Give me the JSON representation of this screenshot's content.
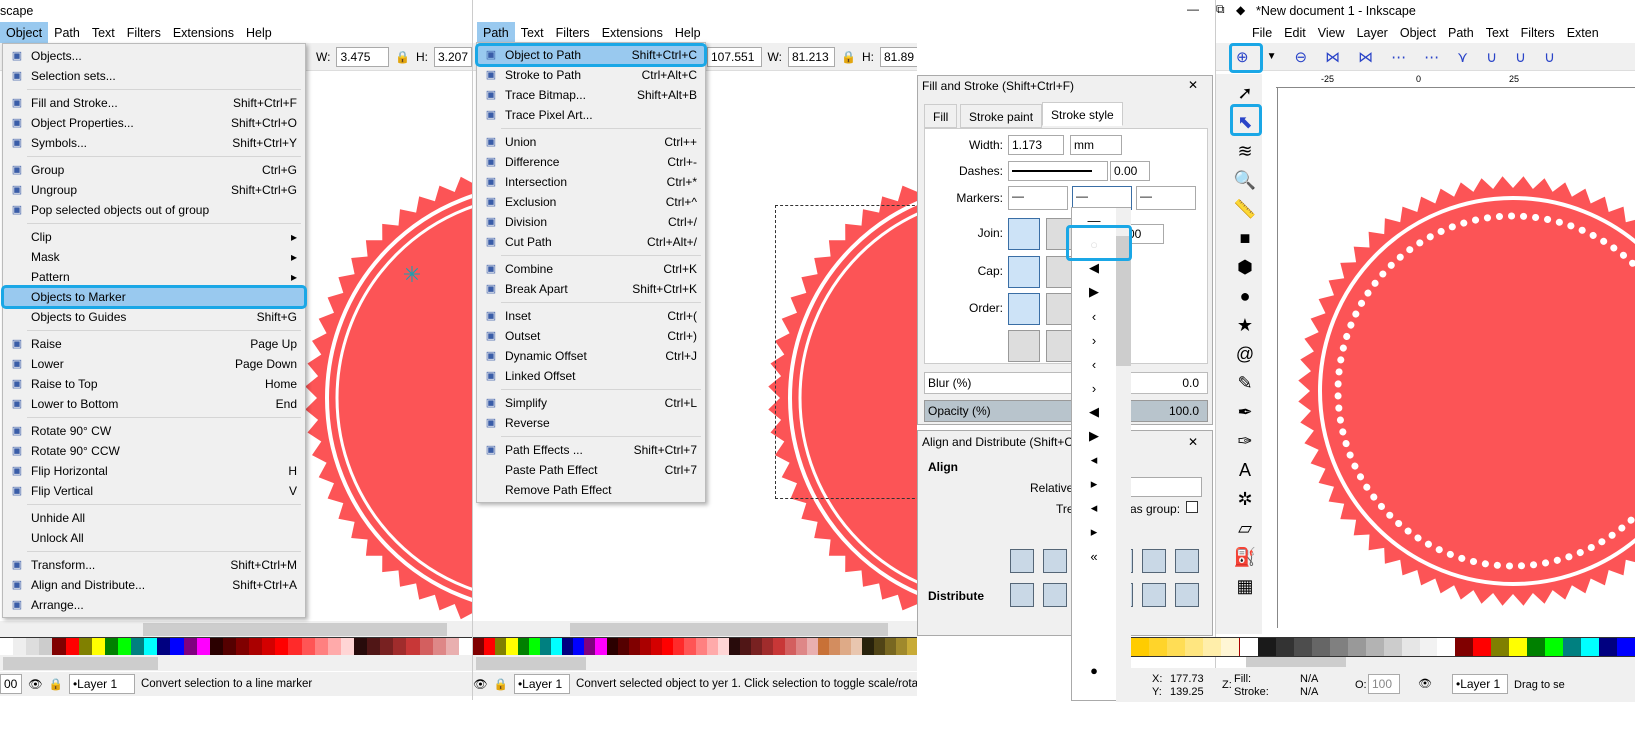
{
  "left_window": {
    "title": "scape",
    "menubar": [
      "Object",
      "Path",
      "Text",
      "Filters",
      "Extensions",
      "Help"
    ],
    "active_menu": "Object",
    "toolbar": {
      "w_label": "W:",
      "w_value": "3.475",
      "h_label": "H:",
      "h_value": "3.207"
    },
    "status": {
      "zoom": "00",
      "layer": "•Layer 1",
      "message": "Convert selection to a line marker"
    }
  },
  "object_menu": [
    [
      {
        "label": "Objects...",
        "icon": "objects-icon"
      },
      {
        "label": "Selection sets...",
        "icon": "selection-sets-icon"
      }
    ],
    [
      {
        "label": "Fill and Stroke...",
        "shortcut": "Shift+Ctrl+F",
        "icon": "fill-stroke-icon"
      },
      {
        "label": "Object Properties...",
        "shortcut": "Shift+Ctrl+O",
        "icon": "object-properties-icon"
      },
      {
        "label": "Symbols...",
        "shortcut": "Shift+Ctrl+Y",
        "icon": "symbols-icon"
      }
    ],
    [
      {
        "label": "Group",
        "shortcut": "Ctrl+G",
        "icon": "group-icon"
      },
      {
        "label": "Ungroup",
        "shortcut": "Shift+Ctrl+G",
        "icon": "ungroup-icon"
      },
      {
        "label": "Pop selected objects out of group",
        "icon": "pop-out-icon"
      }
    ],
    [
      {
        "label": "Clip",
        "submenu": true
      },
      {
        "label": "Mask",
        "submenu": true
      },
      {
        "label": "Pattern",
        "submenu": true
      },
      {
        "label": "Objects to Marker",
        "highlighted": true
      },
      {
        "label": "Objects to Guides",
        "shortcut": "Shift+G"
      }
    ],
    [
      {
        "label": "Raise",
        "shortcut": "Page Up",
        "icon": "raise-icon"
      },
      {
        "label": "Lower",
        "shortcut": "Page Down",
        "icon": "lower-icon"
      },
      {
        "label": "Raise to Top",
        "shortcut": "Home",
        "icon": "raise-top-icon"
      },
      {
        "label": "Lower to Bottom",
        "shortcut": "End",
        "icon": "lower-bottom-icon"
      }
    ],
    [
      {
        "label": "Rotate 90° CW",
        "icon": "rotate-cw-icon"
      },
      {
        "label": "Rotate 90° CCW",
        "icon": "rotate-ccw-icon"
      },
      {
        "label": "Flip Horizontal",
        "shortcut": "H",
        "icon": "flip-horizontal-icon"
      },
      {
        "label": "Flip Vertical",
        "shortcut": "V",
        "icon": "flip-vertical-icon"
      }
    ],
    [
      {
        "label": "Unhide All"
      },
      {
        "label": "Unlock All"
      }
    ],
    [
      {
        "label": "Transform...",
        "shortcut": "Shift+Ctrl+M",
        "icon": "transform-icon"
      },
      {
        "label": "Align and Distribute...",
        "shortcut": "Shift+Ctrl+A",
        "icon": "align-icon"
      },
      {
        "label": "Arrange...",
        "icon": "arrange-icon"
      }
    ]
  ],
  "middle_window": {
    "menubar": [
      "Path",
      "Text",
      "Filters",
      "Extensions",
      "Help"
    ],
    "active_menu": "Path",
    "toolbar": {
      "y_value": "107.551",
      "w_label": "W:",
      "w_value": "81.213",
      "h_label": "H:",
      "h_value": "81.89"
    },
    "status": {
      "layer": "•Layer 1",
      "message": "Convert selected object to yer 1. Click selection to toggle scale/rota"
    }
  },
  "path_menu": [
    [
      {
        "label": "Object to Path",
        "shortcut": "Shift+Ctrl+C",
        "highlighted": true,
        "icon": "object-to-path-icon"
      },
      {
        "label": "Stroke to Path",
        "shortcut": "Ctrl+Alt+C",
        "icon": "stroke-to-path-icon"
      },
      {
        "label": "Trace Bitmap...",
        "shortcut": "Shift+Alt+B",
        "icon": "trace-bitmap-icon"
      },
      {
        "label": "Trace Pixel Art...",
        "icon": "trace-pixel-art-icon"
      }
    ],
    [
      {
        "label": "Union",
        "shortcut": "Ctrl++",
        "icon": "union-icon"
      },
      {
        "label": "Difference",
        "shortcut": "Ctrl+-",
        "icon": "difference-icon"
      },
      {
        "label": "Intersection",
        "shortcut": "Ctrl+*",
        "icon": "intersection-icon"
      },
      {
        "label": "Exclusion",
        "shortcut": "Ctrl+^",
        "icon": "exclusion-icon"
      },
      {
        "label": "Division",
        "shortcut": "Ctrl+/",
        "icon": "division-icon"
      },
      {
        "label": "Cut Path",
        "shortcut": "Ctrl+Alt+/",
        "icon": "cut-path-icon"
      }
    ],
    [
      {
        "label": "Combine",
        "shortcut": "Ctrl+K",
        "icon": "combine-icon"
      },
      {
        "label": "Break Apart",
        "shortcut": "Shift+Ctrl+K",
        "icon": "break-apart-icon"
      }
    ],
    [
      {
        "label": "Inset",
        "shortcut": "Ctrl+(",
        "icon": "inset-icon"
      },
      {
        "label": "Outset",
        "shortcut": "Ctrl+)",
        "icon": "outset-icon"
      },
      {
        "label": "Dynamic Offset",
        "shortcut": "Ctrl+J",
        "icon": "dynamic-offset-icon"
      },
      {
        "label": "Linked Offset",
        "icon": "linked-offset-icon"
      }
    ],
    [
      {
        "label": "Simplify",
        "shortcut": "Ctrl+L",
        "icon": "simplify-icon"
      },
      {
        "label": "Reverse",
        "icon": "reverse-icon"
      }
    ],
    [
      {
        "label": "Path Effects ...",
        "shortcut": "Shift+Ctrl+7",
        "icon": "path-effects-icon"
      },
      {
        "label": "Paste Path Effect",
        "shortcut": "Ctrl+7"
      },
      {
        "label": "Remove Path Effect"
      }
    ]
  ],
  "fill_stroke": {
    "title": "Fill and Stroke (Shift+Ctrl+F)",
    "tabs": [
      "Fill",
      "Stroke paint",
      "Stroke style"
    ],
    "active_tab": "Stroke style",
    "width_label": "Width:",
    "width_value": "1.173",
    "unit": "mm",
    "dashes_label": "Dashes:",
    "dash_offset": "0.00",
    "markers_label": "Markers:",
    "join_label": "Join:",
    "miter_value": "00",
    "cap_label": "Cap:",
    "order_label": "Order:",
    "blur_label": "Blur (%)",
    "blur_value": "0.0",
    "opacity_label": "Opacity (%)",
    "opacity_value": "100.0"
  },
  "align_distribute": {
    "title": "Align and Distribute (Shift+C",
    "align_heading": "Align",
    "relative_label": "Relative",
    "treat_label": "Tre",
    "as_group_label": "as group:",
    "distribute_heading": "Distribute"
  },
  "marker_list": [
    "none",
    "dot-white",
    "arrow-large-left",
    "arrow-large-right",
    "arrow-small-left",
    "arrow-small-right",
    "arrow-tiny-left",
    "arrow-tiny-right",
    "triangle-large-left",
    "triangle-large-right",
    "triangle-small-left",
    "triangle-small-right",
    "triangle-tiny-left",
    "triangle-tiny-right",
    "chevrons-left",
    "dot-large"
  ],
  "right_window": {
    "title": "*New document 1 - Inkscape",
    "menubar": [
      "File",
      "Edit",
      "View",
      "Layer",
      "Object",
      "Path",
      "Text",
      "Filters",
      "Exten"
    ],
    "ruler_labels": [
      "-25",
      "0",
      "25"
    ],
    "status": {
      "x_label": "X:",
      "x_value": "177.73",
      "y_label": "Y:",
      "y_value": "139.25",
      "z_label": "Z:",
      "fill_label": "Fill:",
      "fill_value": "N/A",
      "stroke_label": "Stroke:",
      "stroke_value": "N/A",
      "opacity_label": "O:",
      "opacity_value": "100",
      "layer": "•Layer 1",
      "message": "Drag to se"
    },
    "tools": [
      "selector-icon",
      "node-editor-icon",
      "tweak-icon",
      "zoom-icon",
      "measure-icon",
      "rectangle-icon",
      "3d-box-icon",
      "ellipse-icon",
      "star-icon",
      "spiral-icon",
      "pencil-icon",
      "pen-icon",
      "calligraphy-icon",
      "text-icon",
      "spray-icon",
      "eraser-icon",
      "paint-bucket-icon",
      "gradient-icon"
    ]
  },
  "colors": {
    "accent_highlight": "#1aa7e6",
    "menu_highlight": "#99c9ef",
    "seal_red": "#fc5456"
  },
  "palette_a": [
    "#ffffff",
    "#eeeeee",
    "#dddddd",
    "#cccccc",
    "#800000",
    "#ff0000",
    "#808000",
    "#ffff00",
    "#008000",
    "#00ff00",
    "#008080",
    "#00ffff",
    "#000080",
    "#0000ff",
    "#800080",
    "#ff00ff",
    "#2b0000",
    "#550000",
    "#800000",
    "#aa0000",
    "#d40000",
    "#ff0000",
    "#ff2a2a",
    "#ff5555",
    "#ff8080",
    "#ffaaaa",
    "#ffd5d5",
    "#280b0b",
    "#501616",
    "#782121",
    "#a02c2c",
    "#c83737",
    "#d35f5f",
    "#de8787",
    "#e9afaf",
    "#ffffff"
  ],
  "palette_b": [
    "#800000",
    "#ff0000",
    "#808000",
    "#ffff00",
    "#008000",
    "#00ff00",
    "#008080",
    "#00ffff",
    "#000080",
    "#0000ff",
    "#800080",
    "#ff00ff",
    "#2b0000",
    "#550000",
    "#800000",
    "#aa0000",
    "#d40000",
    "#ff0000",
    "#ff2a2a",
    "#ff5555",
    "#ff8080",
    "#ffaaaa",
    "#ffd5d5",
    "#280b0b",
    "#501616",
    "#782121",
    "#a02c2c",
    "#c83737",
    "#d35f5f",
    "#de8787",
    "#e9afaf",
    "#c87137",
    "#d38d5f",
    "#deaa87",
    "#e9c6af",
    "#28220b",
    "#504416",
    "#786721",
    "#a0892c",
    "#c8ab37"
  ],
  "palette_c": [
    "#ffcc00",
    "#ffd42a",
    "#ffdd55",
    "#ffe680",
    "#ffeeaa",
    "#fff6d5",
    "#1a1a1a",
    "#333333",
    "#4d4d4d",
    "#666666",
    "#808080",
    "#999999",
    "#b3b3b3",
    "#cccccc",
    "#e6e6e6",
    "#f2f2f2",
    "#ffffff",
    "#800000",
    "#ff0000",
    "#808000",
    "#ffff00",
    "#008000",
    "#00ff00",
    "#008080",
    "#00ffff",
    "#000080",
    "#0000ff"
  ]
}
